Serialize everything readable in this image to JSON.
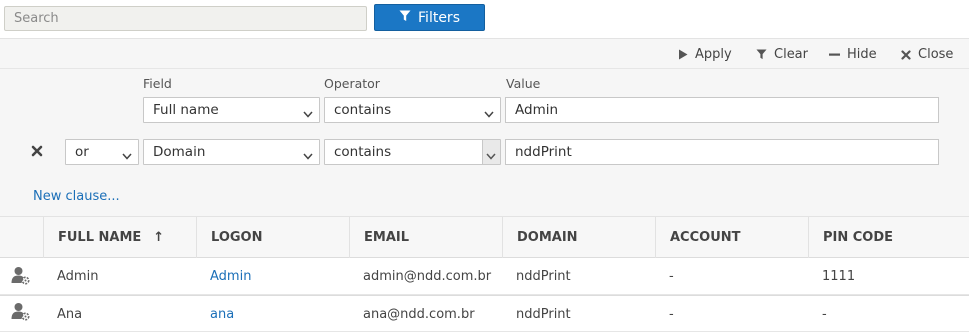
{
  "search": {
    "placeholder": "Search",
    "value": ""
  },
  "filters_button": {
    "label": "Filters",
    "icon": "funnel-icon"
  },
  "panel": {
    "actions": {
      "apply": "Apply",
      "clear": "Clear",
      "hide": "Hide",
      "close": "Close"
    },
    "columns": {
      "field": "Field",
      "operator": "Operator",
      "value": "Value"
    },
    "clauses": [
      {
        "field": "Full name",
        "operator": "contains",
        "value": "Admin"
      },
      {
        "connector": "or",
        "field": "Domain",
        "operator": "contains",
        "value": "nddPrint"
      }
    ],
    "new_clause": "New clause..."
  },
  "table": {
    "columns": [
      "FULL NAME",
      "LOGON",
      "EMAIL",
      "DOMAIN",
      "ACCOUNT",
      "PIN CODE"
    ],
    "sort_indicator": "↑",
    "rows": [
      {
        "full_name": "Admin",
        "logon": "Admin",
        "email": "admin@ndd.com.br",
        "domain": "nddPrint",
        "account": "-",
        "pin_code": "1111"
      },
      {
        "full_name": "Ana",
        "logon": "ana",
        "email": "ana@ndd.com.br",
        "domain": "nddPrint",
        "account": "-",
        "pin_code": "-"
      }
    ]
  },
  "colors": {
    "accent": "#1b77c5",
    "link": "#1b6fb8"
  }
}
